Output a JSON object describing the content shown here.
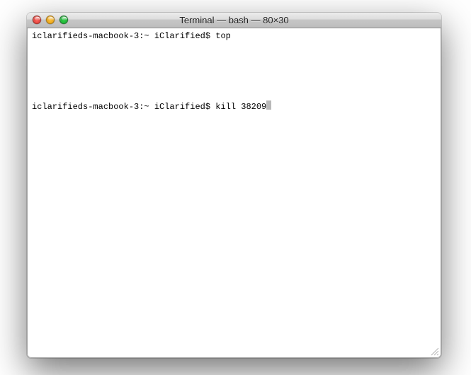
{
  "titlebar": {
    "title": "Terminal — bash — 80×30"
  },
  "terminal": {
    "prompt": "iclarifieds-macbook-3:~ iClarified$ ",
    "line1_cmd": "top",
    "line2_cmd": "kill 38209"
  }
}
